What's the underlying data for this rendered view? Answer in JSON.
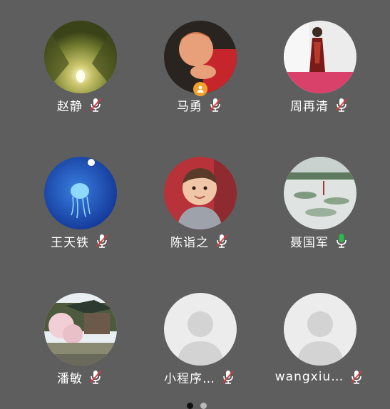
{
  "participants": [
    {
      "name": "赵静",
      "mic": "muted",
      "avatar": "tunnel-photo"
    },
    {
      "name": "马勇",
      "mic": "muted",
      "avatar": "child-photo",
      "host_badge": true
    },
    {
      "name": "周再清",
      "mic": "muted",
      "avatar": "woman-photo"
    },
    {
      "name": "王天铁",
      "mic": "muted",
      "avatar": "jellyfish-photo"
    },
    {
      "name": "陈诣之",
      "mic": "muted",
      "avatar": "toddler-photo"
    },
    {
      "name": "聂国军",
      "mic": "on",
      "avatar": "pond-photo"
    },
    {
      "name": "潘敏",
      "mic": "muted",
      "avatar": "building-photo"
    },
    {
      "name": "小程序…",
      "mic": "muted",
      "avatar": "default-avatar"
    },
    {
      "name": "wangxiu…",
      "mic": "muted",
      "avatar": "default-avatar"
    }
  ],
  "colors": {
    "background": "#5e5e5e",
    "muted_icon": "#ffffff",
    "muted_slash": "#e0373e",
    "active_mic": "#2db84d",
    "host_badge": "#f2a12a"
  },
  "pager": {
    "pages": 2,
    "current": 1
  }
}
